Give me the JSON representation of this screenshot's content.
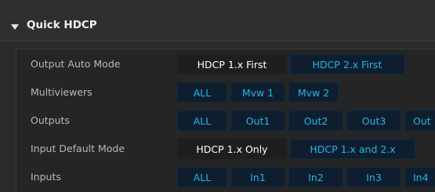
{
  "panel": {
    "title": "Quick HDCP",
    "toggle_icon": "triangle-down-icon"
  },
  "rows": {
    "output_auto_mode": {
      "label": "Output Auto Mode",
      "options": [
        "HDCP 1.x First",
        "HDCP 2.x First"
      ],
      "selected": "HDCP 1.x First"
    },
    "multiviewers": {
      "label": "Multiviewers",
      "options": [
        "ALL",
        "Mvw 1",
        "Mvw 2"
      ]
    },
    "outputs": {
      "label": "Outputs",
      "options": [
        "ALL",
        "Out1",
        "Out2",
        "Out3",
        "Out"
      ]
    },
    "input_default_mode": {
      "label": "Input Default Mode",
      "options": [
        "HDCP 1.x Only",
        "HDCP 1.x and 2.x"
      ],
      "selected": "HDCP 1.x Only"
    },
    "inputs": {
      "label": "Inputs",
      "options": [
        "ALL",
        "In1",
        "In2",
        "In3",
        "In4"
      ]
    }
  },
  "colors": {
    "background": "#2b2b2b",
    "button_bg": "#0f1e2e",
    "button_text": "#27b5e8",
    "selected_bg": "#1e1e1e",
    "selected_text": "#ffffff"
  }
}
